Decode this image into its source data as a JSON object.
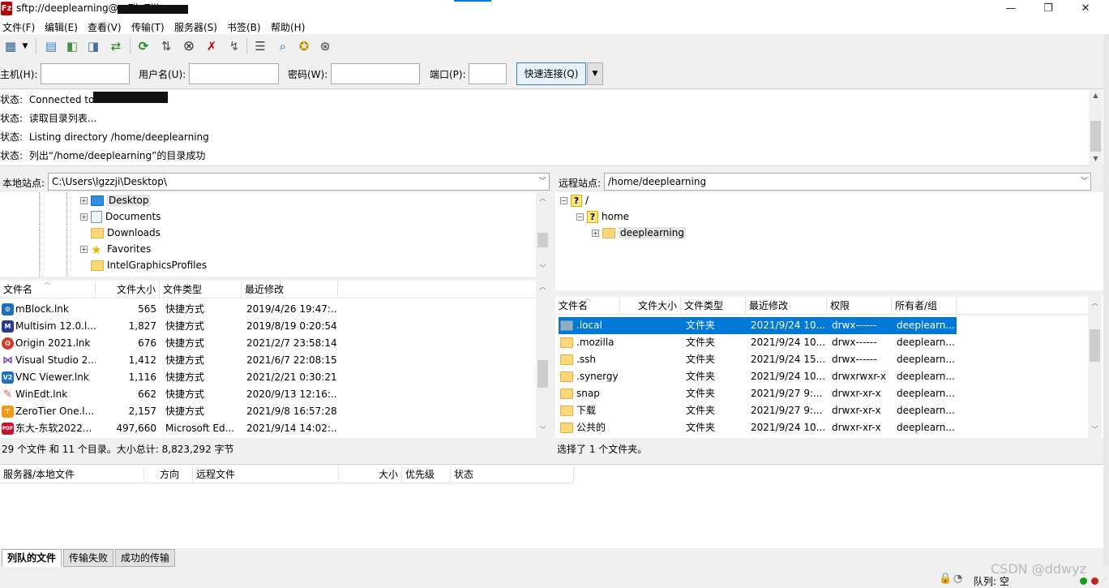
{
  "window": {
    "title": "sftp://deeplearning@                - FileZilla",
    "minimize": "—",
    "maximize": "❐",
    "close": "✕"
  },
  "menu": [
    "文件(F)",
    "编辑(E)",
    "查看(V)",
    "传输(T)",
    "服务器(S)",
    "书签(B)",
    "帮助(H)"
  ],
  "quickconnect": {
    "host_label": "主机(H):",
    "user_label": "用户名(U):",
    "pass_label": "密码(W):",
    "port_label": "端口(P):",
    "host_value": "",
    "user_value": "",
    "pass_value": "",
    "port_value": "",
    "button": "快速连接(Q)"
  },
  "log": [
    {
      "label": "状态:",
      "text": "Connected to"
    },
    {
      "label": "状态:",
      "text": "读取目录列表..."
    },
    {
      "label": "状态:",
      "text": "Listing directory /home/deeplearning"
    },
    {
      "label": "状态:",
      "text": "列出“/home/deeplearning”的目录成功"
    }
  ],
  "local": {
    "site_label": "本地站点:",
    "path": "C:\\Users\\lgzzji\\Desktop\\",
    "tree": [
      "Desktop",
      "Documents",
      "Downloads",
      "Favorites",
      "IntelGraphicsProfiles"
    ],
    "columns": [
      "文件名",
      "文件大小",
      "文件类型",
      "最近修改"
    ],
    "files": [
      {
        "name": "mBlock.lnk",
        "size": "565",
        "type": "快捷方式",
        "modified": "2019/4/26 19:47:..."
      },
      {
        "name": "Multisim 12.0.l...",
        "size": "1,827",
        "type": "快捷方式",
        "modified": "2019/8/19 0:20:54"
      },
      {
        "name": "Origin 2021.lnk",
        "size": "676",
        "type": "快捷方式",
        "modified": "2021/2/7 23:58:14"
      },
      {
        "name": "Visual Studio 2...",
        "size": "1,412",
        "type": "快捷方式",
        "modified": "2021/6/7 22:08:15"
      },
      {
        "name": "VNC Viewer.lnk",
        "size": "1,116",
        "type": "快捷方式",
        "modified": "2021/2/21 0:30:21"
      },
      {
        "name": "WinEdt.lnk",
        "size": "662",
        "type": "快捷方式",
        "modified": "2020/9/13 12:16:..."
      },
      {
        "name": "ZeroTier One.l...",
        "size": "2,157",
        "type": "快捷方式",
        "modified": "2021/9/8 16:57:28"
      },
      {
        "name": "东大-东软2022...",
        "size": "497,660",
        "type": "Microsoft Ed...",
        "modified": "2021/9/14 14:02:..."
      }
    ],
    "status": "29 个文件 和 11 个目录。大小总计: 8,823,292 字节"
  },
  "remote": {
    "site_label": "远程站点:",
    "path": "/home/deeplearning",
    "tree": [
      "/",
      "home",
      "deeplearning"
    ],
    "columns": [
      "文件名",
      "文件大小",
      "文件类型",
      "最近修改",
      "权限",
      "所有者/组"
    ],
    "files": [
      {
        "name": ".local",
        "type": "文件夹",
        "modified": "2021/9/24 10...",
        "perm": "drwx------",
        "owner": "deeplearn..."
      },
      {
        "name": ".mozilla",
        "type": "文件夹",
        "modified": "2021/9/24 10...",
        "perm": "drwx------",
        "owner": "deeplearn..."
      },
      {
        "name": ".ssh",
        "type": "文件夹",
        "modified": "2021/9/24 15...",
        "perm": "drwx------",
        "owner": "deeplearn..."
      },
      {
        "name": ".synergy",
        "type": "文件夹",
        "modified": "2021/9/24 10...",
        "perm": "drwxrwxr-x",
        "owner": "deeplearn..."
      },
      {
        "name": "snap",
        "type": "文件夹",
        "modified": "2021/9/27 9:...",
        "perm": "drwxr-xr-x",
        "owner": "deeplearn..."
      },
      {
        "name": "下载",
        "type": "文件夹",
        "modified": "2021/9/27 9:...",
        "perm": "drwxr-xr-x",
        "owner": "deeplearn..."
      },
      {
        "name": "公共的",
        "type": "文件夹",
        "modified": "2021/9/24 10...",
        "perm": "drwxr-xr-x",
        "owner": "deeplearn..."
      }
    ],
    "status": "选择了 1 个文件夹。"
  },
  "queue": {
    "columns": [
      "服务器/本地文件",
      "方向",
      "远程文件",
      "大小",
      "优先级",
      "状态"
    ],
    "tabs": [
      "列队的文件",
      "传输失败",
      "成功的传输"
    ]
  },
  "footer": {
    "queue_status": "队列: 空",
    "watermark": "CSDN @ddwyz"
  },
  "colors": {
    "selection": "#0078d7",
    "accent_button": "#e5f1fb"
  }
}
